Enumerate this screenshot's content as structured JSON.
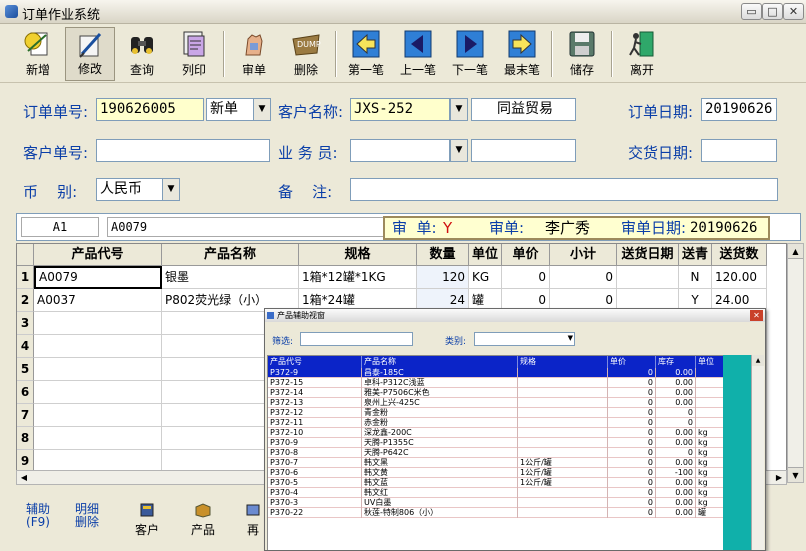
{
  "window": {
    "title": "订单作业系统"
  },
  "toolbar": {
    "buttons": [
      {
        "label": "新增",
        "icon": "new-icon"
      },
      {
        "label": "修改",
        "icon": "edit-icon"
      },
      {
        "label": "查询",
        "icon": "binoculars-icon"
      },
      {
        "label": "列印",
        "icon": "print-icon"
      },
      {
        "label": "审单",
        "icon": "audit-icon"
      },
      {
        "label": "删除",
        "icon": "dump-icon"
      },
      {
        "label": "第一笔",
        "icon": "first-record-icon"
      },
      {
        "label": "上一笔",
        "icon": "prev-record-icon"
      },
      {
        "label": "下一笔",
        "icon": "next-record-icon"
      },
      {
        "label": "最末笔",
        "icon": "last-record-icon"
      },
      {
        "label": "储存",
        "icon": "save-icon"
      },
      {
        "label": "离开",
        "icon": "exit-icon"
      }
    ]
  },
  "form": {
    "order_no_label": "订单单号:",
    "order_no": "190626005",
    "order_type": "新单",
    "customer_name_label": "客户名称:",
    "customer_code": "JXS-252",
    "customer_name": "同益贸易",
    "order_date_label": "订单日期:",
    "order_date": "20190626",
    "customer_order_label": "客户单号:",
    "customer_order": "",
    "salesman_label": "业 务 员:",
    "salesman": "",
    "salesman_name": "",
    "delivery_date_label": "交货日期:",
    "delivery_date": "",
    "currency_label": "币    别:",
    "currency": "人民币",
    "remark_label": "备    注:",
    "remark": ""
  },
  "cellbar": {
    "ref": "A1",
    "value": "A0079",
    "audit_label": "审  单:",
    "audit_flag": "Y",
    "auditor_label": "审单:",
    "auditor": "李广秀",
    "audit_date_label": "审单日期:",
    "audit_date": "20190626"
  },
  "grid": {
    "columns": [
      "产品代号",
      "产品名称",
      "规格",
      "数量",
      "单位",
      "单价",
      "小计",
      "送货日期",
      "送青",
      "送货数"
    ],
    "row_numbers": [
      "1",
      "2",
      "3",
      "4",
      "5",
      "6",
      "7",
      "8",
      "9"
    ],
    "rows": [
      [
        "A0079",
        "银墨",
        "1箱*12罐*1KG",
        "120",
        "KG",
        "0",
        "0",
        "",
        "N",
        "120.00"
      ],
      [
        "A0037",
        "P802荧光绿（小）",
        "1箱*24罐",
        "24",
        "罐",
        "0",
        "0",
        "",
        "Y",
        "24.00"
      ]
    ]
  },
  "bottom": {
    "assist": "辅助\n(F9)",
    "detail_delete": "明细\n删除",
    "customer": "客户",
    "product": "产品",
    "partial": "再"
  },
  "popup": {
    "title": "产品辅助视窗",
    "filter_label": "筛选:",
    "category_label": "类别:",
    "columns": [
      "产品代号",
      "产品名称",
      "规格",
      "单价",
      "库存",
      "单位"
    ],
    "rows": [
      [
        "P372-9",
        "昌泰-185C",
        "",
        "0",
        "0.00",
        ""
      ],
      [
        "P372-15",
        "卓科-P312C浅蓝",
        "",
        "0",
        "0.00",
        ""
      ],
      [
        "P372-14",
        "雅美-P7506C米色",
        "",
        "0",
        "0.00",
        ""
      ],
      [
        "P372-13",
        "泉州上兴-425C",
        "",
        "0",
        "0.00",
        ""
      ],
      [
        "P372-12",
        "青金粉",
        "",
        "0",
        "0",
        ""
      ],
      [
        "P372-11",
        "赤金粉",
        "",
        "0",
        "0",
        ""
      ],
      [
        "P372-10",
        "深龙鑫-200C",
        "",
        "0",
        "0.00",
        "kg"
      ],
      [
        "P370-9",
        "天腾-P1355C",
        "",
        "0",
        "0.00",
        "kg"
      ],
      [
        "P370-8",
        "天腾-P642C",
        "",
        "0",
        "0",
        "kg"
      ],
      [
        "P370-7",
        "韩文黑",
        "1公斤/罐",
        "0",
        "0.00",
        "kg"
      ],
      [
        "P370-6",
        "韩文黄",
        "1公斤/罐",
        "0",
        "-100",
        "kg"
      ],
      [
        "P370-5",
        "韩文蓝",
        "1公斤/罐",
        "0",
        "0.00",
        "kg"
      ],
      [
        "P370-4",
        "韩文红",
        "",
        "0",
        "0.00",
        "kg"
      ],
      [
        "P370-3",
        "UV白墨",
        "",
        "0",
        "0.00",
        "kg"
      ],
      [
        "P370-22",
        "秋莲-特制806（小）",
        "",
        "0",
        "0.00",
        "罐"
      ]
    ]
  }
}
